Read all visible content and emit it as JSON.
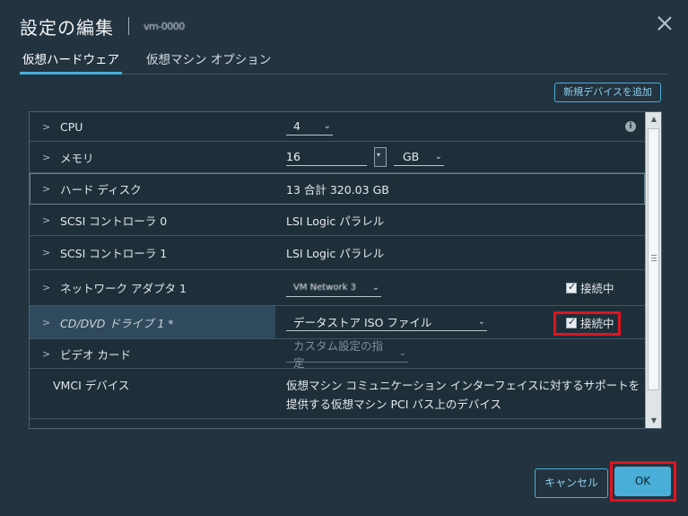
{
  "dialog": {
    "title": "設定の編集",
    "vm_name": "vm-0000",
    "close_label": ""
  },
  "tabs": [
    {
      "label": "仮想ハードウェア",
      "active": true
    },
    {
      "label": "仮想マシン オプション",
      "active": false
    }
  ],
  "toolbar": {
    "add_device_label": "新規デバイスを追加"
  },
  "hardware": {
    "cpu": {
      "label": "CPU",
      "value": "4"
    },
    "memory": {
      "label": "メモリ",
      "value": "16",
      "unit": "GB"
    },
    "disk": {
      "label": "ハード ディスク",
      "value": "13 合計 320.03 GB"
    },
    "scsi0": {
      "label": "SCSI コントローラ 0",
      "value": "LSI Logic パラレル"
    },
    "scsi1": {
      "label": "SCSI コントローラ 1",
      "value": "LSI Logic パラレル"
    },
    "network": {
      "label": "ネットワーク アダプタ 1",
      "value": "VM Network 3",
      "connected_label": "接続中",
      "connected": true
    },
    "cddvd": {
      "label": "CD/DVD ドライブ 1 *",
      "value": "データストア ISO ファイル",
      "connected_label": "接続中",
      "connected": true
    },
    "video": {
      "label": "ビデオ カード",
      "value": "カスタム設定の指定"
    },
    "vmci": {
      "label": "VMCI デバイス",
      "value": "仮想マシン コミュニケーション インターフェイスに対するサポートを提供する仮想マシン PCI バス上のデバイス"
    }
  },
  "footer": {
    "cancel_label": "キャンセル",
    "ok_label": "OK"
  },
  "colors": {
    "accent": "#49afd9",
    "highlight": "#e0141e",
    "background": "#233340"
  }
}
